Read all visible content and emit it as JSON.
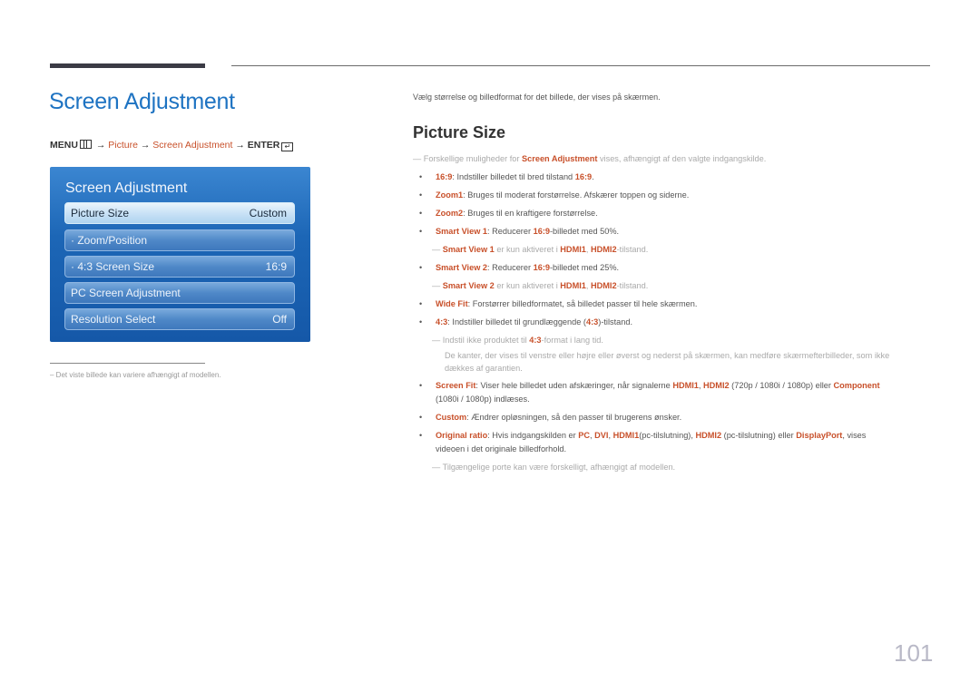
{
  "page": {
    "title": "Screen Adjustment",
    "page_number": "101"
  },
  "menu_path": {
    "menu": "MENU",
    "arrow": "→",
    "picture": "Picture",
    "screen_adjustment": "Screen Adjustment",
    "enter": "ENTER",
    "enter_icon": "↵"
  },
  "osd": {
    "title": "Screen Adjustment",
    "items": [
      {
        "label": "Picture Size",
        "value": "Custom"
      },
      {
        "label": "· Zoom/Position",
        "value": ""
      },
      {
        "label": "· 4:3 Screen Size",
        "value": "16:9"
      },
      {
        "label": "PC Screen Adjustment",
        "value": ""
      },
      {
        "label": "Resolution Select",
        "value": "Off"
      }
    ]
  },
  "footnote": "–  Det viste billede kan variere afhængigt af modellen.",
  "right": {
    "intro": "Vælg størrelse og billedformat for det billede, der vises på skærmen.",
    "section_title": "Picture Size",
    "note1": {
      "pre": "Forskellige muligheder for ",
      "hl": "Screen Adjustment",
      "post": " vises, afhængigt af den valgte indgangskilde."
    },
    "b1": {
      "k": "16:9",
      "t": ": Indstiller billedet til bred tilstand ",
      "k2": "16:9",
      "t2": "."
    },
    "b2": {
      "k": "Zoom1",
      "t": ": Bruges til moderat forstørrelse. Afskærer toppen og siderne."
    },
    "b3": {
      "k": "Zoom2",
      "t": ": Bruges til en kraftigere forstørrelse."
    },
    "b4": {
      "k": "Smart View 1",
      "t": ": Reducerer ",
      "k2": "16:9",
      "t2": "-billedet med 50%."
    },
    "n4": {
      "k": "Smart View 1",
      "t": " er kun aktiveret i ",
      "k2": "HDMI1",
      "t2": ", ",
      "k3": "HDMI2",
      "t3": "-tilstand."
    },
    "b5": {
      "k": "Smart View 2",
      "t": ": Reducerer ",
      "k2": "16:9",
      "t2": "-billedet med 25%."
    },
    "n5": {
      "k": "Smart View 2",
      "t": " er kun aktiveret i ",
      "k2": "HDMI1",
      "t2": ", ",
      "k3": "HDMI2",
      "t3": "-tilstand."
    },
    "b6": {
      "k": "Wide Fit",
      "t": ": Forstørrer billedformatet, så billedet passer til hele skærmen."
    },
    "b7": {
      "k": "4:3",
      "t": ": Indstiller billedet til grundlæggende (",
      "k2": "4:3",
      "t2": ")-tilstand."
    },
    "n7": {
      "t": "Indstil ikke produktet til ",
      "k": "4:3",
      "t2": "-format i lang tid."
    },
    "n7b": "De kanter, der vises til venstre eller højre eller øverst og nederst på skærmen, kan medføre skærmefterbilleder, som ikke",
    "n7c": "dækkes af garantien.",
    "b8": {
      "k": "Screen Fit",
      "t": ": Viser hele billedet uden afskæringer, når signalerne ",
      "k2": "HDMI1",
      "t2": ", ",
      "k3": "HDMI2",
      "t3": " (720p / 1080i / 1080p) eller ",
      "k4": "Component"
    },
    "b8b": "(1080i / 1080p) indlæses.",
    "b9": {
      "k": "Custom",
      "t": ": Ændrer opløsningen, så den passer til brugerens ønsker."
    },
    "b10": {
      "k": "Original ratio",
      "t": ": Hvis indgangskilden er ",
      "k2": "PC",
      "t2": ", ",
      "k3": "DVI",
      "t3": ", ",
      "k4": "HDMI1",
      "t4": "(pc-tilslutning), ",
      "k5": "HDMI2",
      "t5": " (pc-tilslutning) eller ",
      "k6": "DisplayPort",
      "t6": ", vises"
    },
    "b10b": "videoen i det originale billedforhold.",
    "n10": "Tilgængelige porte kan være forskelligt, afhængigt af modellen.",
    "bullet": "•",
    "dash": "―"
  }
}
